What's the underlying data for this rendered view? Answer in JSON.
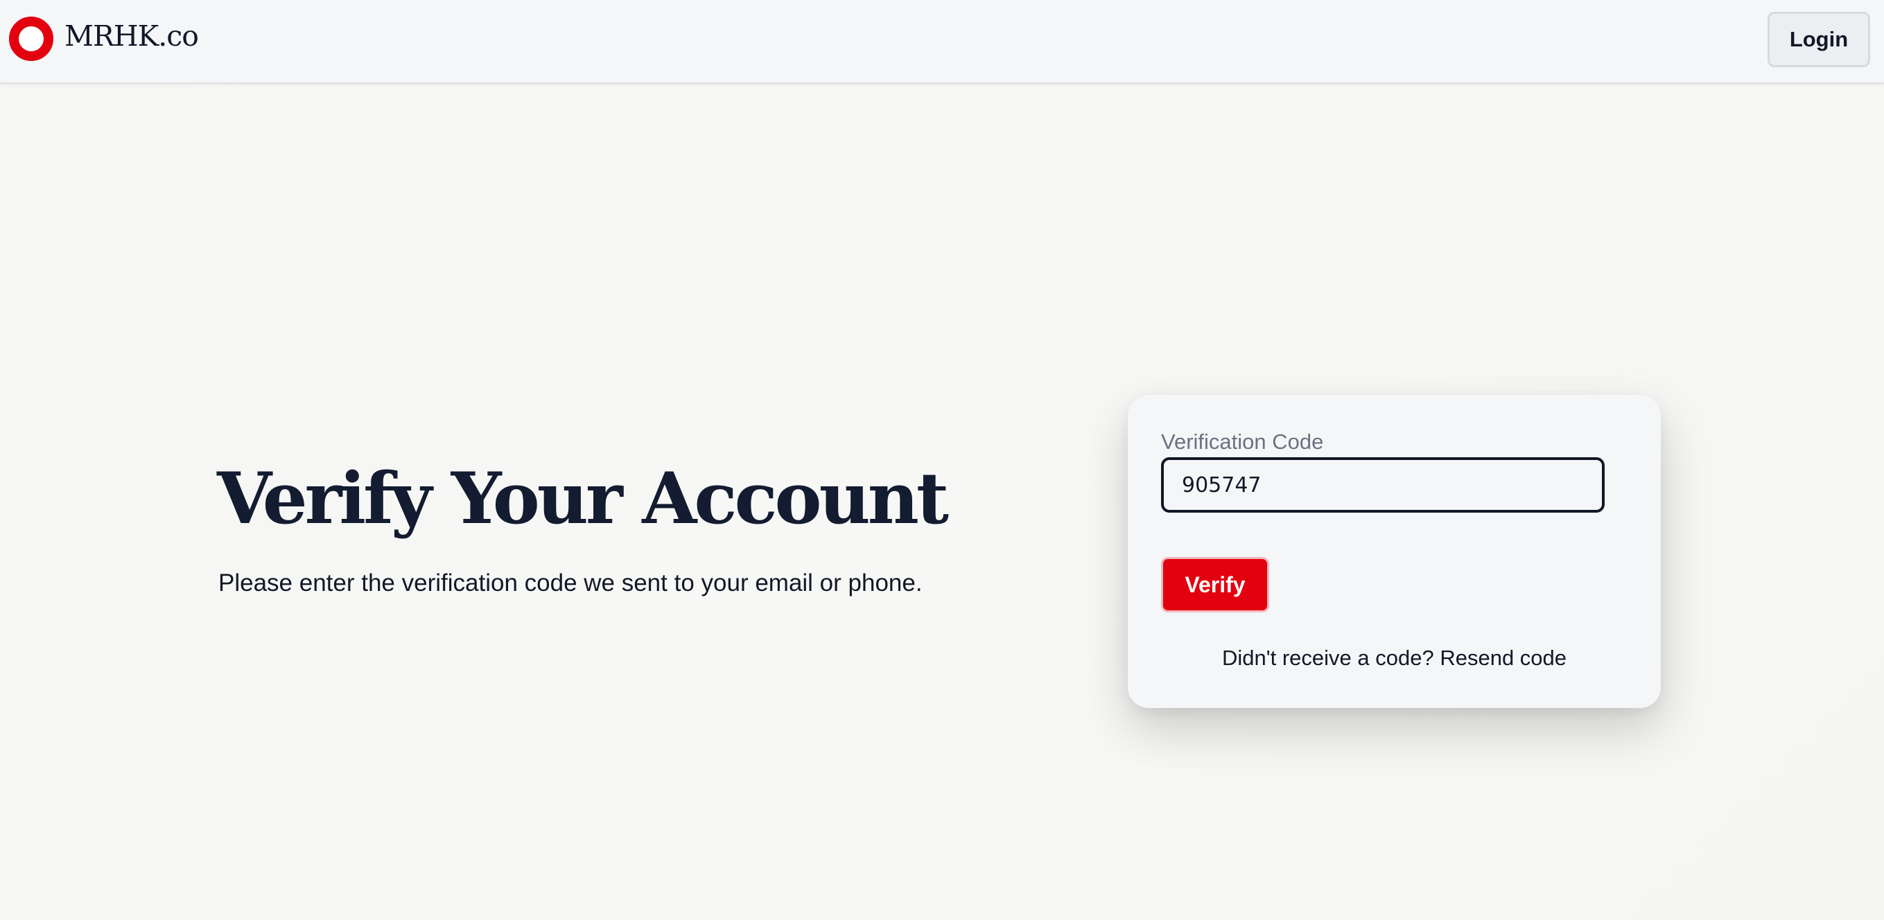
{
  "header": {
    "logo_icon": "red-ring-logo-icon",
    "brand_name": "MRHK.co",
    "login_label": "Login"
  },
  "hero": {
    "title": "Verify Your Account",
    "subtitle": "Please enter the verification code we sent to your email or phone."
  },
  "form": {
    "code_label": "Verification Code",
    "code_value": "905747",
    "verify_label": "Verify",
    "resend_prompt": "Didn't receive a code?",
    "resend_link": "Resend code"
  },
  "colors": {
    "accent": "#e3000f",
    "text": "#111827",
    "muted": "#6b7280",
    "surface": "#f5f6f8"
  }
}
